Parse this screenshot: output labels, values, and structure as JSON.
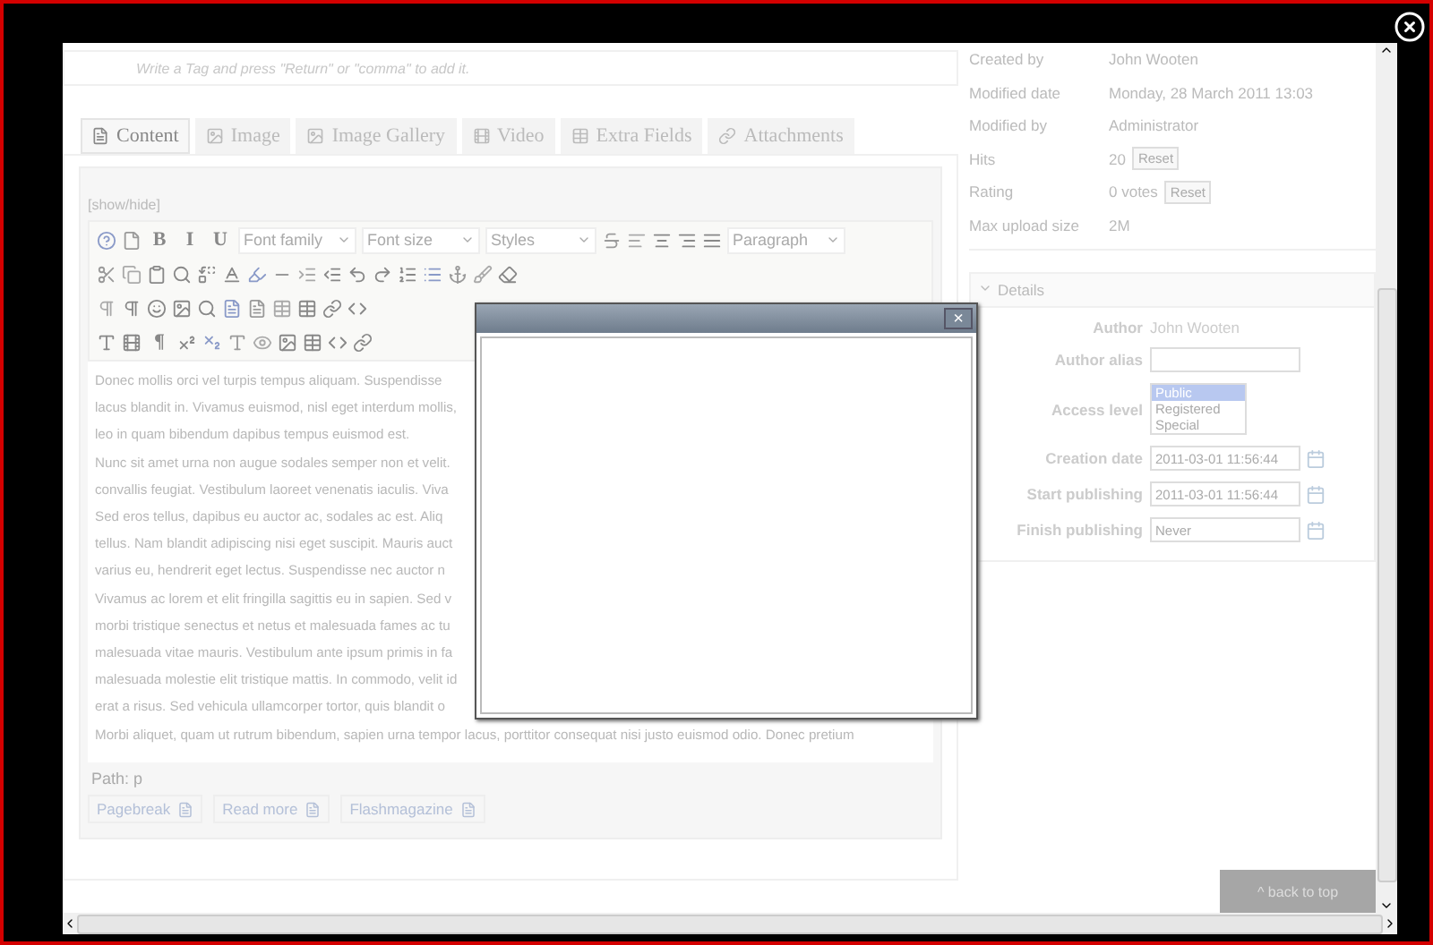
{
  "tag_field": {
    "placeholder": "Write a Tag and press \"Return\" or \"comma\" to add it."
  },
  "tabs": [
    {
      "label": "Content",
      "selected": true
    },
    {
      "label": "Image",
      "selected": false
    },
    {
      "label": "Image Gallery",
      "selected": false
    },
    {
      "label": "Video",
      "selected": false
    },
    {
      "label": "Extra Fields",
      "selected": false
    },
    {
      "label": "Attachments",
      "selected": false
    }
  ],
  "editor": {
    "toggle": "[show/hide]",
    "toolbar": [
      [
        {
          "kind": "icon"
        },
        {
          "kind": "icon"
        },
        {
          "kind": "text",
          "label": "B"
        },
        {
          "kind": "text",
          "label": "I"
        },
        {
          "kind": "text",
          "label": "U"
        },
        {
          "kind": "select",
          "label": "Font family"
        },
        {
          "kind": "select",
          "label": "Font size"
        },
        {
          "kind": "select",
          "label": "Styles"
        },
        {
          "kind": "icon"
        },
        {
          "kind": "icon"
        },
        {
          "kind": "icon"
        },
        {
          "kind": "icon"
        },
        {
          "kind": "icon"
        },
        {
          "kind": "select",
          "label": "Paragraph"
        }
      ],
      [
        {
          "kind": "icon"
        },
        {
          "kind": "icon"
        },
        {
          "kind": "icon"
        },
        {
          "kind": "icon"
        },
        {
          "kind": "icon"
        },
        {
          "kind": "icon"
        },
        {
          "kind": "icon"
        },
        {
          "kind": "icon"
        },
        {
          "kind": "icon"
        },
        {
          "kind": "icon"
        },
        {
          "kind": "icon"
        },
        {
          "kind": "icon"
        },
        {
          "kind": "icon"
        },
        {
          "kind": "icon"
        },
        {
          "kind": "icon"
        },
        {
          "kind": "icon"
        },
        {
          "kind": "icon"
        }
      ],
      [
        {
          "kind": "icon"
        },
        {
          "kind": "icon"
        },
        {
          "kind": "icon"
        },
        {
          "kind": "icon"
        },
        {
          "kind": "icon"
        },
        {
          "kind": "icon"
        },
        {
          "kind": "icon"
        },
        {
          "kind": "icon"
        },
        {
          "kind": "icon"
        },
        {
          "kind": "icon"
        },
        {
          "kind": "icon"
        }
      ],
      [
        {
          "kind": "icon"
        },
        {
          "kind": "icon"
        },
        {
          "kind": "text",
          "label": "¶"
        },
        {
          "kind": "icon"
        },
        {
          "kind": "icon"
        },
        {
          "kind": "icon"
        },
        {
          "kind": "icon"
        },
        {
          "kind": "icon"
        },
        {
          "kind": "icon"
        },
        {
          "kind": "icon"
        },
        {
          "kind": "icon"
        }
      ]
    ],
    "lines": [
      "Donec mollis orci vel turpis tempus aliquam. Suspendisse",
      "lacus blandit in. Vivamus euismod, nisl eget interdum mollis,",
      "leo in quam bibendum dapibus tempus euismod est.",
      "Nunc sit amet urna non augue sodales semper non et velit.",
      "convallis feugiat. Vestibulum laoreet venenatis iaculis. Viva",
      "Sed eros tellus, dapibus eu auctor ac, sodales ac est. Aliq",
      "tellus. Nam blandit adipiscing nisi eget suscipit. Mauris auct",
      "varius eu, hendrerit eget lectus. Suspendisse nec auctor n",
      "Vivamus ac lorem et elit fringilla sagittis eu in sapien. Sed v",
      "morbi tristique senectus et netus et malesuada fames ac tu",
      "malesuada vitae mauris. Vestibulum ante ipsum primis in fa",
      "malesuada molestie elit tristique mattis. In commodo, velit id",
      "erat a risus. Sed vehicula ullamcorper tortor, quis blandit o",
      "Morbi aliquet, quam ut rutrum bibendum, sapien urna tempor lacus, porttitor consequat nisi justo euismod odio. Donec pretium"
    ],
    "path": "Path: p",
    "buttons": [
      "Pagebreak",
      "Read more",
      "Flashmagazine"
    ]
  },
  "meta": [
    {
      "label": "Created by",
      "value": "John Wooten"
    },
    {
      "label": "Modified date",
      "value": "Monday, 28 March 2011 13:03"
    },
    {
      "label": "Modified by",
      "value": "Administrator"
    },
    {
      "label": "Hits",
      "value": "20",
      "button": "Reset"
    },
    {
      "label": "Rating",
      "value": "0 votes",
      "button": "Reset"
    },
    {
      "label": "Max upload size",
      "value": "2M"
    }
  ],
  "details": {
    "title": "Details",
    "expanded": true,
    "fields": [
      {
        "kind": "text",
        "label": "Author",
        "value": "John Wooten"
      },
      {
        "kind": "input",
        "label": "Author alias"
      },
      {
        "kind": "listbox",
        "label": "Access level",
        "options": [
          {
            "label": "Public",
            "selected": true
          },
          {
            "label": "Registered",
            "selected": false
          },
          {
            "label": "Special",
            "selected": false
          }
        ]
      },
      {
        "kind": "date",
        "label": "Creation date",
        "value": "2011-03-01 11:56:44"
      },
      {
        "kind": "date",
        "label": "Start publishing",
        "value": "2011-03-01 11:56:44"
      },
      {
        "kind": "date",
        "label": "Finish publishing",
        "value": "Never"
      }
    ]
  },
  "back_to_top": "^ back to top",
  "dialog": {
    "close": "×"
  }
}
